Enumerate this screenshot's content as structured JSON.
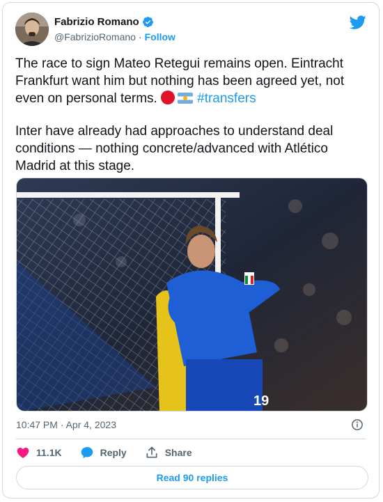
{
  "author": {
    "name": "Fabrizio Romano",
    "handle": "@FabrizioRomano",
    "separator": "·",
    "follow_label": "Follow"
  },
  "tweet": {
    "paragraph1": "The race to sign Mateo Retegui remains open. Eintracht Frankfurt want him but nothing has been agreed yet, not even on personal terms.",
    "hashtag": "#transfers",
    "paragraph2": "Inter have already had approaches to understand deal conditions — nothing concrete/advanced with Atlético Madrid at this stage."
  },
  "photo": {
    "jersey_number": "19"
  },
  "meta": {
    "timestamp": "10:47 PM · Apr 4, 2023"
  },
  "actions": {
    "like_count": "11.1K",
    "reply_label": "Reply",
    "share_label": "Share"
  },
  "read_replies_label": "Read 90 replies",
  "colors": {
    "accent": "#1d9bf0",
    "like": "#f91880",
    "text": "#0f1419",
    "secondary": "#536471",
    "border": "#cfd9de"
  },
  "icons": [
    "twitter-bird-icon",
    "verified-badge-icon",
    "heart-icon",
    "reply-bubble-icon",
    "share-icon",
    "info-icon"
  ]
}
